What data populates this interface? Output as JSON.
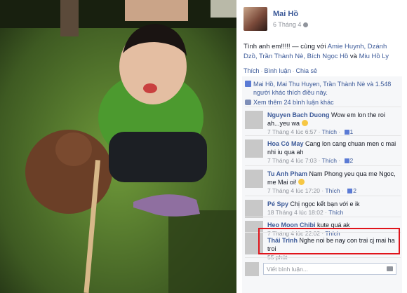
{
  "post": {
    "author": "Mai Hồ",
    "time": "6 Tháng 4",
    "caption_prefix": "Tình anh em!!!!! — cùng với ",
    "tagged": "Amie Huynh, Dzánh Dzồ, Trần Thành Nè, Bích Ngọc Hồ",
    "caption_and": " và ",
    "tagged_last": "Miu Hồ Ly",
    "actions": {
      "like": "Thích",
      "comment": "Bình luận",
      "share": "Chia sẻ"
    },
    "likes_text": "Mai Hồ, Mai Thu Huyen, Trần Thành Nè và 1.548 người khác thích điều này.",
    "more_comments": "Xem thêm 24 bình luận khác",
    "comments": [
      {
        "author": "Nguyen Bach Duong",
        "text": "Wow em lon the roi ah...yeu wa",
        "time": "7 Tháng 4 lúc 6:57",
        "like": "Thích",
        "likes": "1"
      },
      {
        "author": "Hoa Cỏ May",
        "text": "Cang lon cang chuan men c mai nhi iu qua ah",
        "time": "7 Tháng 4 lúc 7:03",
        "like": "Thích",
        "likes": "2"
      },
      {
        "author": "Tu Anh Pham",
        "text": "Nam Phong yeu qua me Ngoc, me Mai oi!",
        "time": "7 Tháng 4 lúc 17:20",
        "like": "Thích",
        "likes": "2"
      },
      {
        "author": "Pé Spy",
        "text": "Chị ngọc kết bạn với e ik",
        "time": "18 Tháng 4 lúc 18:02",
        "like": "Thích",
        "likes": ""
      },
      {
        "author": "Heo Moon Chibi",
        "text": "kute quá ak",
        "time": "7 Tháng 4 lúc 22:02",
        "like": "Thích",
        "likes": ""
      },
      {
        "author": "Thái Trinh",
        "text": "Nghe noi be nay con trai cj mai ha troi",
        "time": "55 phút",
        "like": "",
        "likes": ""
      }
    ],
    "composer_placeholder": "Viết bình luận..."
  },
  "colors": {
    "link": "#3b5998",
    "highlight": "#e0141b"
  }
}
